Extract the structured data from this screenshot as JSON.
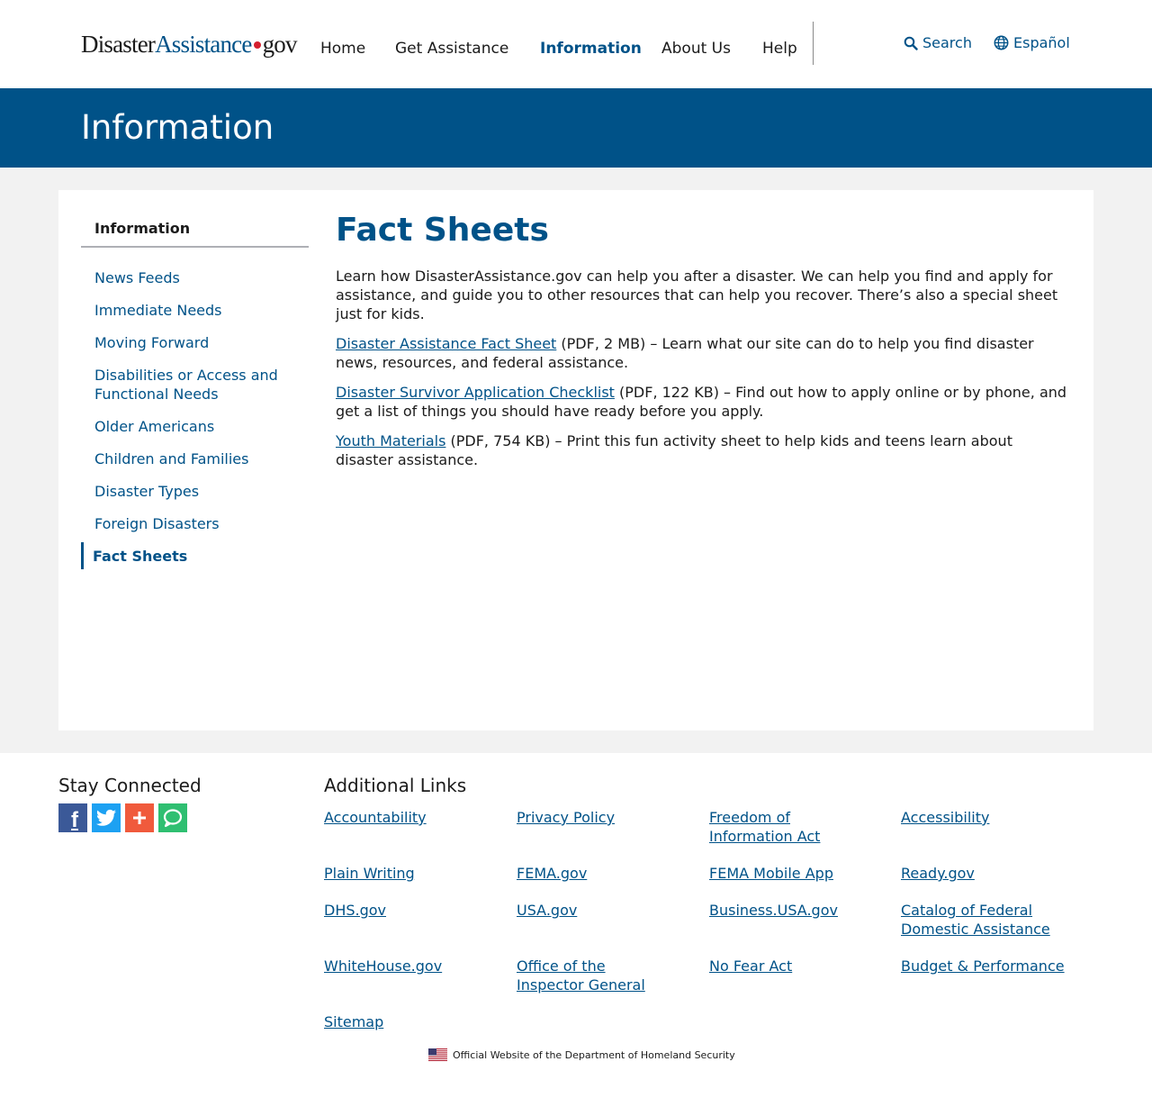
{
  "header": {
    "logo": {
      "part1": "Disaster",
      "part2": "Assistance",
      "part3": "gov"
    },
    "nav": [
      "Home",
      "Get Assistance",
      "Information",
      "About Us",
      "Help"
    ],
    "active_nav": "Information",
    "search_label": "Search",
    "language_label": "Español"
  },
  "banner": {
    "title": "Information"
  },
  "sidebar": {
    "title": "Information",
    "items": [
      "News Feeds",
      "Immediate Needs",
      "Moving Forward",
      "Disabilities or Access and Functional Needs",
      "Older Americans",
      "Children and Families",
      "Disaster Types",
      "Foreign Disasters",
      "Fact Sheets"
    ],
    "current": "Fact Sheets"
  },
  "content": {
    "title": "Fact Sheets",
    "intro": "Learn how DisasterAssistance.gov can help you after a disaster. We can help you find and apply for assistance, and guide you to other resources that can help you recover. There’s also a special sheet just for kids.",
    "docs": [
      {
        "link": "Disaster Assistance Fact Sheet",
        "desc": " (PDF, 2 MB) – Learn what our site can do to help you find disaster news, resources, and federal assistance."
      },
      {
        "link": "Disaster Survivor Application Checklist",
        "desc": " (PDF, 122 KB) – Find out how to apply online or by phone, and get a list of things you should have ready before you apply."
      },
      {
        "link": "Youth Materials",
        "desc": " (PDF, 754 KB) – Print this fun activity sheet to help kids and teens learn about disaster assistance."
      }
    ]
  },
  "footer": {
    "stay_connected": "Stay Connected",
    "social": [
      {
        "icon": "facebook-icon",
        "color": "#3b5998"
      },
      {
        "icon": "twitter-icon",
        "color": "#1da1f2"
      },
      {
        "icon": "add-share-icon",
        "color": "#f05a3c"
      },
      {
        "icon": "text-message-icon",
        "color": "#2fbf71"
      }
    ],
    "additional_links_title": "Additional Links",
    "links": [
      "Accountability",
      "Privacy Policy",
      "Freedom of Information Act",
      "Accessibility",
      "Plain Writing",
      "FEMA.gov",
      "FEMA Mobile App",
      "Ready.gov",
      "DHS.gov",
      "USA.gov",
      "Business.USA.gov",
      "Catalog of Federal Domestic Assistance",
      "WhiteHouse.gov",
      "Office of the Inspector General",
      "No Fear Act",
      "Budget & Performance",
      "Sitemap"
    ],
    "official_text": "Official Website of the Department of Homeland Security"
  },
  "colors": {
    "primary": "#005288",
    "logo_dot": "#d5202f",
    "page_bg": "#f2f2f2"
  }
}
